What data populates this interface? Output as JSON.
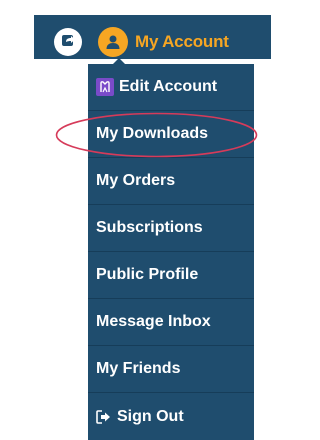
{
  "header": {
    "share_icon": "share-arrow-icon",
    "avatar_icon": "user-icon",
    "account_label": "My Account",
    "accent_color": "#f6a623",
    "bar_color": "#1f4d6e"
  },
  "menu": {
    "items": [
      {
        "label": "Edit Account",
        "icon": "edit-account-icon"
      },
      {
        "label": "My Downloads",
        "icon": ""
      },
      {
        "label": "My Orders",
        "icon": ""
      },
      {
        "label": "Subscriptions",
        "icon": ""
      },
      {
        "label": "Public Profile",
        "icon": ""
      },
      {
        "label": "Message Inbox",
        "icon": ""
      },
      {
        "label": "My Friends",
        "icon": ""
      },
      {
        "label": "Sign Out",
        "icon": "sign-out-icon"
      }
    ],
    "highlighted_item": "My Downloads",
    "highlight_color": "#d63b5a"
  }
}
